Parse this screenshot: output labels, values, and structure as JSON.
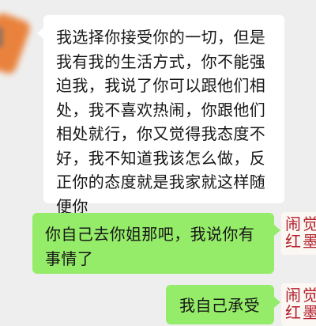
{
  "messages": [
    {
      "sender": "contact",
      "lines": [
        "我选择你接受你的一切，但是",
        "我有我的生活方式，你不能强",
        "迫我，我说了你可以跟他们相",
        "处，我不喜欢热闹，你跟他们",
        "相处就行，你又觉得我态度不",
        "好，我不知道我该怎么做，反",
        "正你的态度就是我家就这样随",
        "便你"
      ]
    },
    {
      "sender": "me",
      "lines": [
        "你自己去你姐那吧，我说你有",
        "事情了"
      ]
    },
    {
      "sender": "me",
      "lines": [
        "我自己承受"
      ]
    }
  ],
  "my_avatar": {
    "text_lines": [
      "闹觉",
      "红墨"
    ],
    "color": "#b3202c"
  },
  "colors": {
    "background": "#eeeeee",
    "incoming_bubble": "#ffffff",
    "outgoing_bubble": "#95ec69"
  }
}
